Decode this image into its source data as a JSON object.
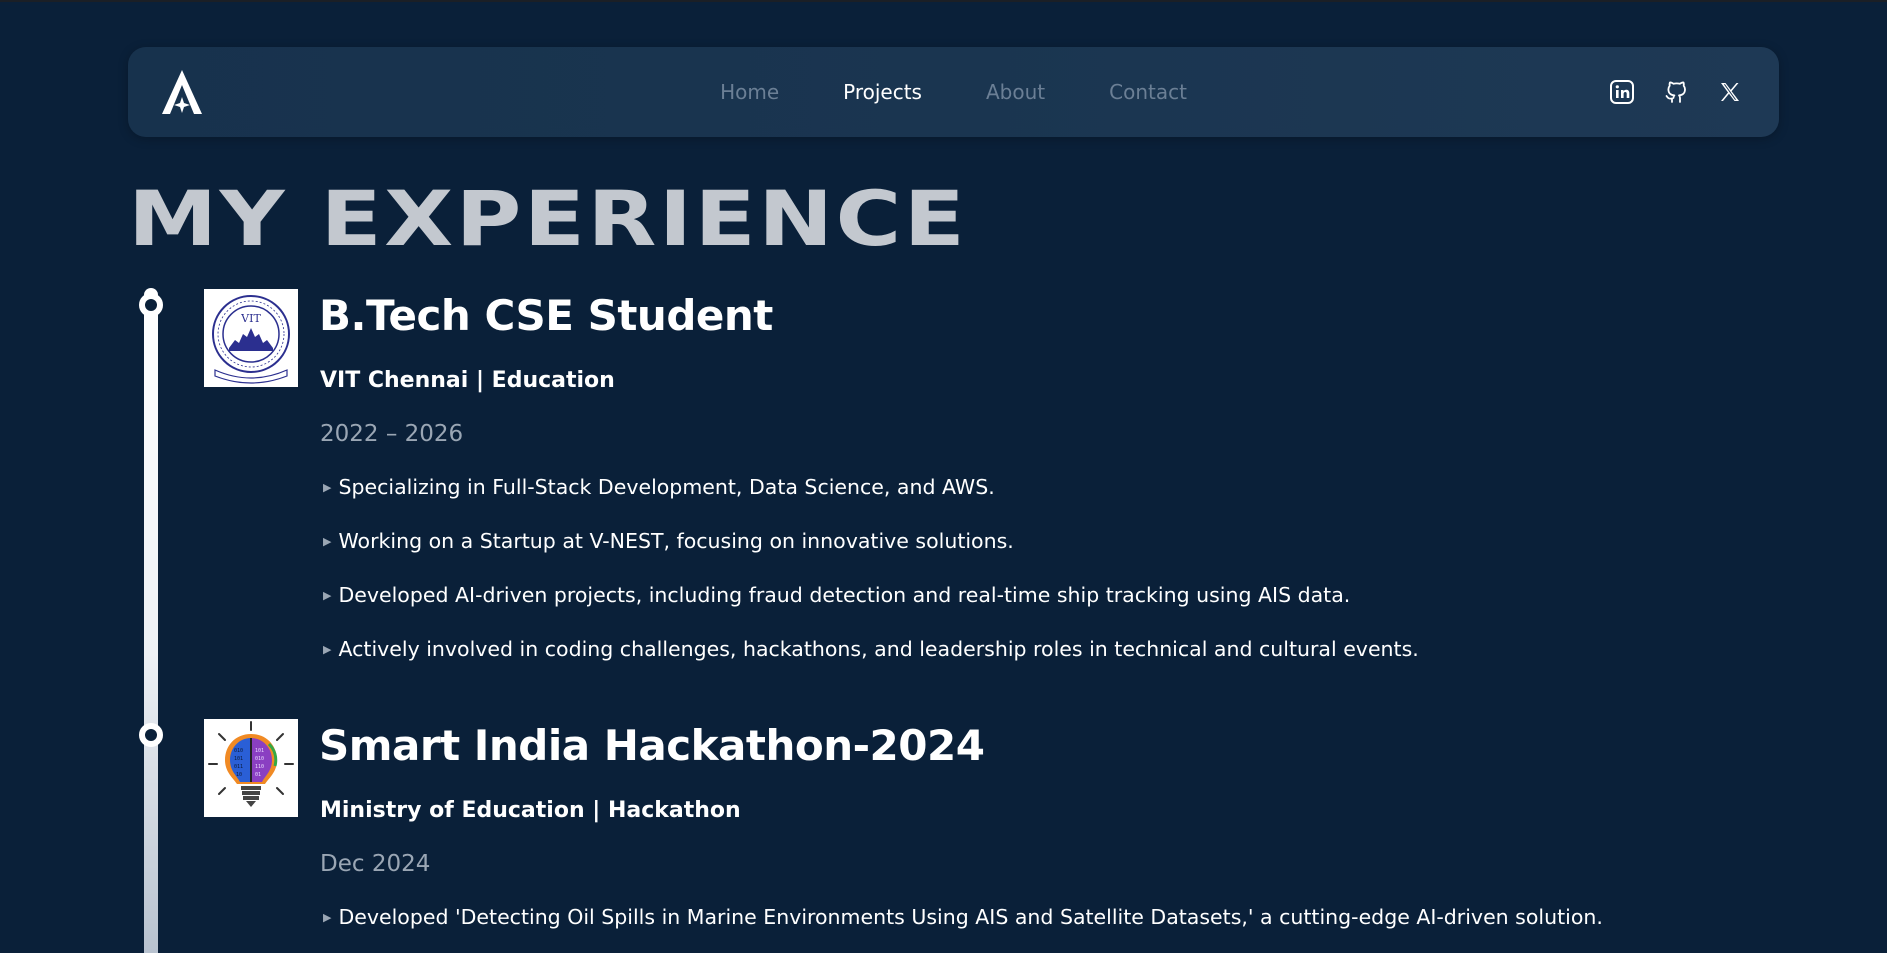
{
  "nav": {
    "links": [
      {
        "label": "Home",
        "active": false
      },
      {
        "label": "Projects",
        "active": true
      },
      {
        "label": "About",
        "active": false
      },
      {
        "label": "Contact",
        "active": false
      }
    ],
    "socials": [
      "linkedin-icon",
      "github-icon",
      "x-icon"
    ]
  },
  "page": {
    "title": "MY EXPERIENCE"
  },
  "experiences": [
    {
      "logo": "vit-logo",
      "logo_text": "VIT",
      "title": "B.Tech CSE Student",
      "org": "VIT Chennai | Education",
      "date": "2022 – 2026",
      "bullets": [
        "Specializing in Full-Stack Development, Data Science, and AWS.",
        "Working on a Startup at V-NEST, focusing on innovative solutions.",
        "Developed AI-driven projects, including fraud detection and real-time ship tracking using AIS data.",
        "Actively involved in coding challenges, hackathons, and leadership roles in technical and cultural events."
      ]
    },
    {
      "logo": "hackathon-bulb-logo",
      "title": "Smart India Hackathon-2024",
      "org": "Ministry of Education | Hackathon",
      "date": "Dec 2024",
      "bullets": [
        "Developed 'Detecting Oil Spills in Marine Environments Using AIS and Satellite Datasets,' a cutting-edge AI-driven solution."
      ]
    }
  ],
  "colors": {
    "background": "#0a2039",
    "navbar": "#1a3550",
    "title": "#c3c8cf",
    "muted": "#9aa6b4",
    "nav_inactive": "#6b7f95"
  }
}
